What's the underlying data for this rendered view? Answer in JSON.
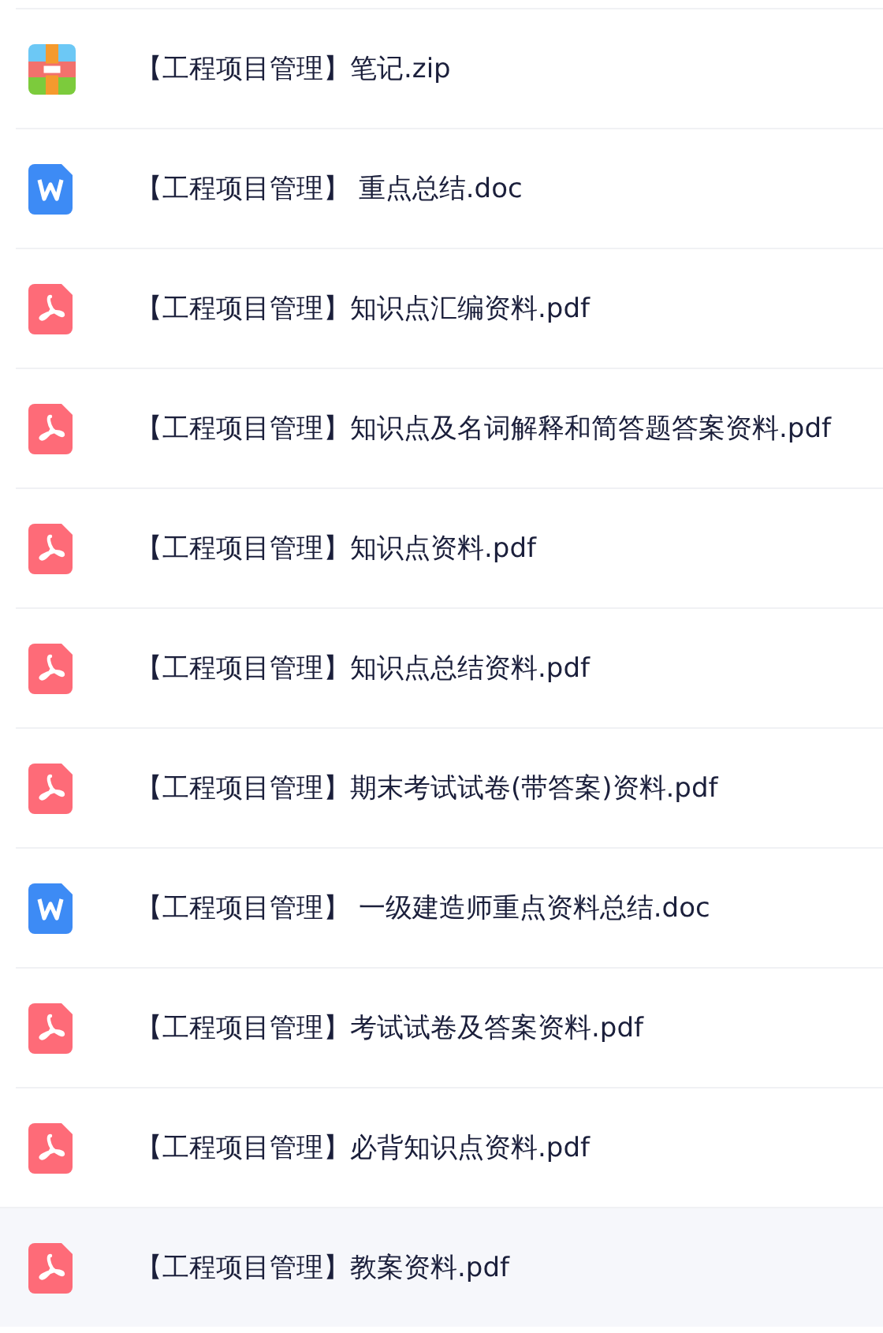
{
  "files": [
    {
      "kind": "zip",
      "name": "【工程项目管理】笔记.zip",
      "selected": false
    },
    {
      "kind": "doc",
      "name": "【工程项目管理】 重点总结.doc",
      "selected": false
    },
    {
      "kind": "pdf",
      "name": "【工程项目管理】知识点汇编资料.pdf",
      "selected": false
    },
    {
      "kind": "pdf",
      "name": "【工程项目管理】知识点及名词解释和简答题答案资料.pdf",
      "selected": false
    },
    {
      "kind": "pdf",
      "name": "【工程项目管理】知识点资料.pdf",
      "selected": false
    },
    {
      "kind": "pdf",
      "name": "【工程项目管理】知识点总结资料.pdf",
      "selected": false
    },
    {
      "kind": "pdf",
      "name": "【工程项目管理】期末考试试卷(带答案)资料.pdf",
      "selected": false
    },
    {
      "kind": "doc",
      "name": "【工程项目管理】 一级建造师重点资料总结.doc",
      "selected": false
    },
    {
      "kind": "pdf",
      "name": "【工程项目管理】考试试卷及答案资料.pdf",
      "selected": false
    },
    {
      "kind": "pdf",
      "name": "【工程项目管理】必背知识点资料.pdf",
      "selected": false
    },
    {
      "kind": "pdf",
      "name": "【工程项目管理】教案资料.pdf",
      "selected": true
    }
  ]
}
